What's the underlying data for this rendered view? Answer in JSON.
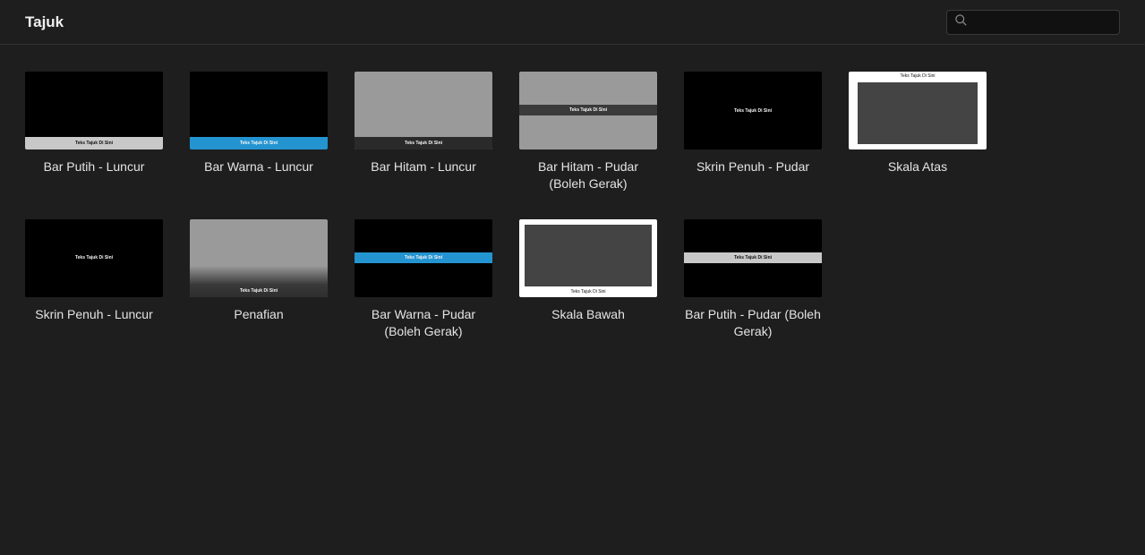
{
  "header": {
    "title": "Tajuk",
    "search_placeholder": ""
  },
  "sample_text": "Teks Tajuk Di Sini",
  "colors": {
    "accent_blue": "#2494d1",
    "bar_white": "#c8c8c8",
    "bg_gray": "#9a9a9a",
    "bg_dark": "#444444",
    "bg_black": "#000000"
  },
  "items": [
    {
      "id": "bar-putih-luncur",
      "label": "Bar Putih - Luncur",
      "thumb": "bar_putih_luncur"
    },
    {
      "id": "bar-warna-luncur",
      "label": "Bar Warna - Luncur",
      "thumb": "bar_warna_luncur"
    },
    {
      "id": "bar-hitam-luncur",
      "label": "Bar Hitam - Luncur",
      "thumb": "bar_hitam_luncur"
    },
    {
      "id": "bar-hitam-pudar",
      "label": "Bar Hitam - Pudar (Boleh Gerak)",
      "thumb": "bar_hitam_pudar"
    },
    {
      "id": "skrin-penuh-pudar",
      "label": "Skrin Penuh - Pudar",
      "thumb": "skrin_penuh_pudar"
    },
    {
      "id": "skala-atas",
      "label": "Skala Atas",
      "thumb": "skala_atas"
    },
    {
      "id": "skrin-penuh-luncur",
      "label": "Skrin Penuh - Luncur",
      "thumb": "skrin_penuh_luncur"
    },
    {
      "id": "penafian",
      "label": "Penafian",
      "thumb": "penafian"
    },
    {
      "id": "bar-warna-pudar",
      "label": "Bar Warna - Pudar (Boleh Gerak)",
      "thumb": "bar_warna_pudar"
    },
    {
      "id": "skala-bawah",
      "label": "Skala Bawah",
      "thumb": "skala_bawah"
    },
    {
      "id": "bar-putih-pudar",
      "label": "Bar Putih - Pudar (Boleh Gerak)",
      "thumb": "bar_putih_pudar"
    }
  ]
}
